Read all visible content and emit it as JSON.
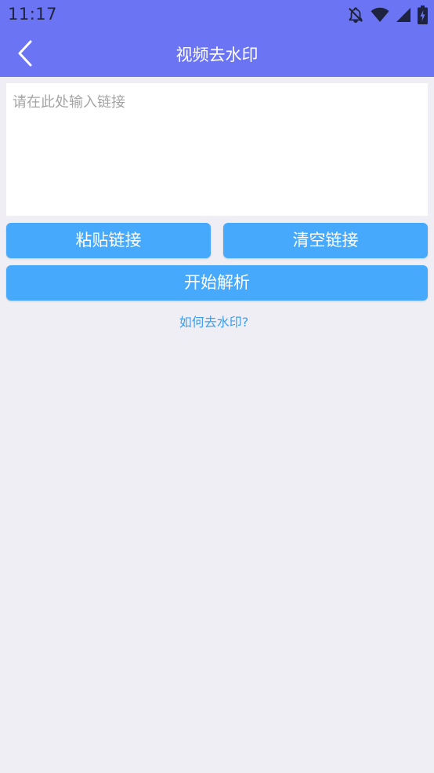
{
  "status_bar": {
    "time": "11:17",
    "icons": [
      "notifications-off-icon",
      "wifi-icon",
      "signal-icon",
      "battery-charging-icon"
    ]
  },
  "app_bar": {
    "back_icon": "chevron-left-icon",
    "title": "视频去水印"
  },
  "main": {
    "link_input": {
      "value": "",
      "placeholder": "请在此处输入链接"
    },
    "paste_button": "粘贴链接",
    "clear_button": "清空链接",
    "parse_button": "开始解析",
    "help_link": "如何去水印?"
  },
  "colors": {
    "primary": "#6b75f4",
    "button": "#46a9fb",
    "link": "#3f9ee8",
    "background": "#efeef4"
  }
}
